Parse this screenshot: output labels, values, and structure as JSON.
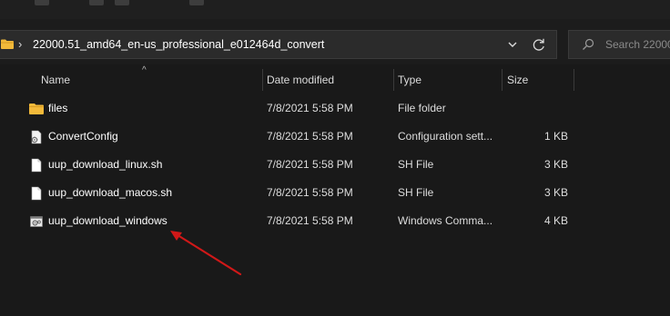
{
  "address_bar": {
    "separator": "›",
    "path": "22000.51_amd64_en-us_professional_e012464d_convert"
  },
  "search": {
    "placeholder": "Search 22000..."
  },
  "columns": {
    "name": "Name",
    "date_modified": "Date modified",
    "type": "Type",
    "size": "Size"
  },
  "files": [
    {
      "name": "files",
      "date": "7/8/2021 5:58 PM",
      "type": "File folder",
      "size": "",
      "icon": "folder-icon"
    },
    {
      "name": "ConvertConfig",
      "date": "7/8/2021 5:58 PM",
      "type": "Configuration sett...",
      "size": "1 KB",
      "icon": "config-file-icon"
    },
    {
      "name": "uup_download_linux.sh",
      "date": "7/8/2021 5:58 PM",
      "type": "SH File",
      "size": "3 KB",
      "icon": "document-icon"
    },
    {
      "name": "uup_download_macos.sh",
      "date": "7/8/2021 5:58 PM",
      "type": "SH File",
      "size": "3 KB",
      "icon": "document-icon"
    },
    {
      "name": "uup_download_windows",
      "date": "7/8/2021 5:58 PM",
      "type": "Windows Comma...",
      "size": "4 KB",
      "icon": "batch-file-icon"
    }
  ],
  "colors": {
    "background": "#191919",
    "folder": "#f2b93a",
    "annotation_arrow": "#d01818"
  }
}
